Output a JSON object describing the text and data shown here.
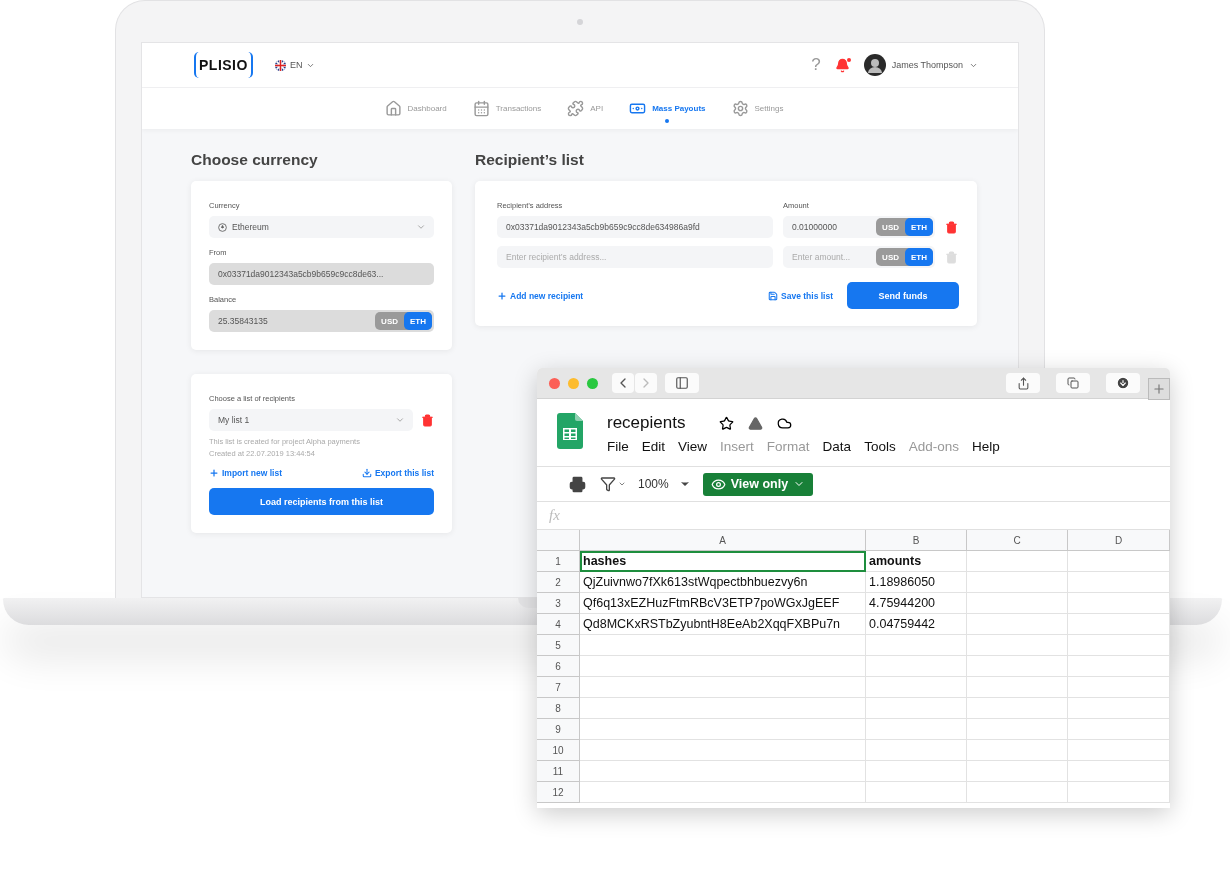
{
  "app": {
    "logo": "PLISIO",
    "language": "EN",
    "help": "?",
    "notifications": true,
    "user_name": "James Thompson"
  },
  "nav": [
    {
      "label": "Dashboard",
      "selected": false
    },
    {
      "label": "Transactions",
      "selected": false
    },
    {
      "label": "API",
      "selected": false
    },
    {
      "label": "Mass Payouts",
      "selected": true
    },
    {
      "label": "Settings",
      "selected": false
    }
  ],
  "currency_panel": {
    "title": "Choose currency",
    "currency_label": "Currency",
    "currency": "Ethereum",
    "from_label": "From",
    "from": "0x03371da9012343a5cb9b659c9cc8de63...",
    "balance_label": "Balance",
    "balance": "25.35843135",
    "units": [
      {
        "label": "USD",
        "selected": false
      },
      {
        "label": "ETH",
        "selected": true
      }
    ]
  },
  "list_panel": {
    "label": "Choose a list of recipients",
    "list": "My list 1",
    "description": "This list is created for project Alpha payments",
    "created": "Created at 22.07.2019 13:44:54",
    "import": "Import new list",
    "export": "Export this list",
    "load": "Load recipients from this list"
  },
  "recipients": {
    "title": "Recipient’s list",
    "address_label": "Recipient’s address",
    "amount_label": "Amount",
    "rows": [
      {
        "address": "0x03371da9012343a5cb9b659c9cc8de634986a9fd",
        "amount": "0.01000000",
        "disabled": false,
        "units": [
          {
            "label": "USD",
            "selected": false
          },
          {
            "label": "ETH",
            "selected": true
          }
        ]
      },
      {
        "address_placeholder": "Enter recipient’s address...",
        "amount_placeholder": "Enter amount...",
        "disabled": true,
        "units": [
          {
            "label": "USD",
            "selected": false
          },
          {
            "label": "ETH",
            "selected": true
          }
        ]
      }
    ],
    "add": "Add new recipient",
    "save": "Save this list",
    "send": "Send funds"
  },
  "spreadsheet": {
    "title": "recepients",
    "menu": [
      {
        "label": "File",
        "disabled": false
      },
      {
        "label": "Edit",
        "disabled": false
      },
      {
        "label": "View",
        "disabled": false
      },
      {
        "label": "Insert",
        "disabled": true
      },
      {
        "label": "Format",
        "disabled": true
      },
      {
        "label": "Data",
        "disabled": false
      },
      {
        "label": "Tools",
        "disabled": false
      },
      {
        "label": "Add-ons",
        "disabled": true
      },
      {
        "label": "Help",
        "disabled": false
      }
    ],
    "zoom": "100%",
    "mode": "View only",
    "formula_label": "fx",
    "columns": [
      "A",
      "B",
      "C",
      "D"
    ],
    "rows": [
      {
        "number": "1",
        "bold": true,
        "cells": [
          {
            "text": "hashes",
            "selected": true
          },
          {
            "text": "amounts",
            "selected": false
          }
        ]
      },
      {
        "number": "2",
        "bold": false,
        "cells": [
          {
            "text": "QjZuivnwo7fXk613stWqpectbhbuezvy6n",
            "selected": false
          },
          {
            "text": "1.18986050",
            "selected": false
          }
        ]
      },
      {
        "number": "3",
        "bold": false,
        "cells": [
          {
            "text": "Qf6q13xEZHuzFtmRBcV3ETP7poWGxJgEEF",
            "selected": false
          },
          {
            "text": "4.75944200",
            "selected": false
          }
        ]
      },
      {
        "number": "4",
        "bold": false,
        "cells": [
          {
            "text": "Qd8MCKxRSTbZyubntH8EeAb2XqqFXBPu7n",
            "selected": false
          },
          {
            "text": "0.04759442",
            "selected": false
          }
        ]
      },
      {
        "number": "5"
      },
      {
        "number": "6"
      },
      {
        "number": "7"
      },
      {
        "number": "8"
      },
      {
        "number": "9"
      },
      {
        "number": "10"
      },
      {
        "number": "11"
      },
      {
        "number": "12"
      }
    ]
  }
}
